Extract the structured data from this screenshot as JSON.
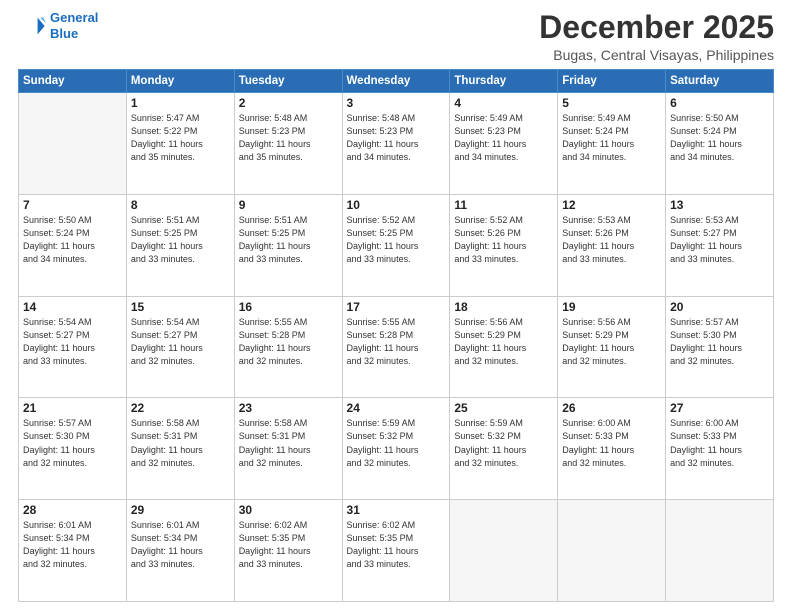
{
  "header": {
    "logo_line1": "General",
    "logo_line2": "Blue",
    "title": "December 2025",
    "subtitle": "Bugas, Central Visayas, Philippines"
  },
  "calendar": {
    "days_of_week": [
      "Sunday",
      "Monday",
      "Tuesday",
      "Wednesday",
      "Thursday",
      "Friday",
      "Saturday"
    ],
    "weeks": [
      [
        {
          "day": "",
          "info": ""
        },
        {
          "day": "1",
          "info": "Sunrise: 5:47 AM\nSunset: 5:22 PM\nDaylight: 11 hours\nand 35 minutes."
        },
        {
          "day": "2",
          "info": "Sunrise: 5:48 AM\nSunset: 5:23 PM\nDaylight: 11 hours\nand 35 minutes."
        },
        {
          "day": "3",
          "info": "Sunrise: 5:48 AM\nSunset: 5:23 PM\nDaylight: 11 hours\nand 34 minutes."
        },
        {
          "day": "4",
          "info": "Sunrise: 5:49 AM\nSunset: 5:23 PM\nDaylight: 11 hours\nand 34 minutes."
        },
        {
          "day": "5",
          "info": "Sunrise: 5:49 AM\nSunset: 5:24 PM\nDaylight: 11 hours\nand 34 minutes."
        },
        {
          "day": "6",
          "info": "Sunrise: 5:50 AM\nSunset: 5:24 PM\nDaylight: 11 hours\nand 34 minutes."
        }
      ],
      [
        {
          "day": "7",
          "info": "Sunrise: 5:50 AM\nSunset: 5:24 PM\nDaylight: 11 hours\nand 34 minutes."
        },
        {
          "day": "8",
          "info": "Sunrise: 5:51 AM\nSunset: 5:25 PM\nDaylight: 11 hours\nand 33 minutes."
        },
        {
          "day": "9",
          "info": "Sunrise: 5:51 AM\nSunset: 5:25 PM\nDaylight: 11 hours\nand 33 minutes."
        },
        {
          "day": "10",
          "info": "Sunrise: 5:52 AM\nSunset: 5:25 PM\nDaylight: 11 hours\nand 33 minutes."
        },
        {
          "day": "11",
          "info": "Sunrise: 5:52 AM\nSunset: 5:26 PM\nDaylight: 11 hours\nand 33 minutes."
        },
        {
          "day": "12",
          "info": "Sunrise: 5:53 AM\nSunset: 5:26 PM\nDaylight: 11 hours\nand 33 minutes."
        },
        {
          "day": "13",
          "info": "Sunrise: 5:53 AM\nSunset: 5:27 PM\nDaylight: 11 hours\nand 33 minutes."
        }
      ],
      [
        {
          "day": "14",
          "info": "Sunrise: 5:54 AM\nSunset: 5:27 PM\nDaylight: 11 hours\nand 33 minutes."
        },
        {
          "day": "15",
          "info": "Sunrise: 5:54 AM\nSunset: 5:27 PM\nDaylight: 11 hours\nand 32 minutes."
        },
        {
          "day": "16",
          "info": "Sunrise: 5:55 AM\nSunset: 5:28 PM\nDaylight: 11 hours\nand 32 minutes."
        },
        {
          "day": "17",
          "info": "Sunrise: 5:55 AM\nSunset: 5:28 PM\nDaylight: 11 hours\nand 32 minutes."
        },
        {
          "day": "18",
          "info": "Sunrise: 5:56 AM\nSunset: 5:29 PM\nDaylight: 11 hours\nand 32 minutes."
        },
        {
          "day": "19",
          "info": "Sunrise: 5:56 AM\nSunset: 5:29 PM\nDaylight: 11 hours\nand 32 minutes."
        },
        {
          "day": "20",
          "info": "Sunrise: 5:57 AM\nSunset: 5:30 PM\nDaylight: 11 hours\nand 32 minutes."
        }
      ],
      [
        {
          "day": "21",
          "info": "Sunrise: 5:57 AM\nSunset: 5:30 PM\nDaylight: 11 hours\nand 32 minutes."
        },
        {
          "day": "22",
          "info": "Sunrise: 5:58 AM\nSunset: 5:31 PM\nDaylight: 11 hours\nand 32 minutes."
        },
        {
          "day": "23",
          "info": "Sunrise: 5:58 AM\nSunset: 5:31 PM\nDaylight: 11 hours\nand 32 minutes."
        },
        {
          "day": "24",
          "info": "Sunrise: 5:59 AM\nSunset: 5:32 PM\nDaylight: 11 hours\nand 32 minutes."
        },
        {
          "day": "25",
          "info": "Sunrise: 5:59 AM\nSunset: 5:32 PM\nDaylight: 11 hours\nand 32 minutes."
        },
        {
          "day": "26",
          "info": "Sunrise: 6:00 AM\nSunset: 5:33 PM\nDaylight: 11 hours\nand 32 minutes."
        },
        {
          "day": "27",
          "info": "Sunrise: 6:00 AM\nSunset: 5:33 PM\nDaylight: 11 hours\nand 32 minutes."
        }
      ],
      [
        {
          "day": "28",
          "info": "Sunrise: 6:01 AM\nSunset: 5:34 PM\nDaylight: 11 hours\nand 32 minutes."
        },
        {
          "day": "29",
          "info": "Sunrise: 6:01 AM\nSunset: 5:34 PM\nDaylight: 11 hours\nand 33 minutes."
        },
        {
          "day": "30",
          "info": "Sunrise: 6:02 AM\nSunset: 5:35 PM\nDaylight: 11 hours\nand 33 minutes."
        },
        {
          "day": "31",
          "info": "Sunrise: 6:02 AM\nSunset: 5:35 PM\nDaylight: 11 hours\nand 33 minutes."
        },
        {
          "day": "",
          "info": ""
        },
        {
          "day": "",
          "info": ""
        },
        {
          "day": "",
          "info": ""
        }
      ]
    ]
  }
}
